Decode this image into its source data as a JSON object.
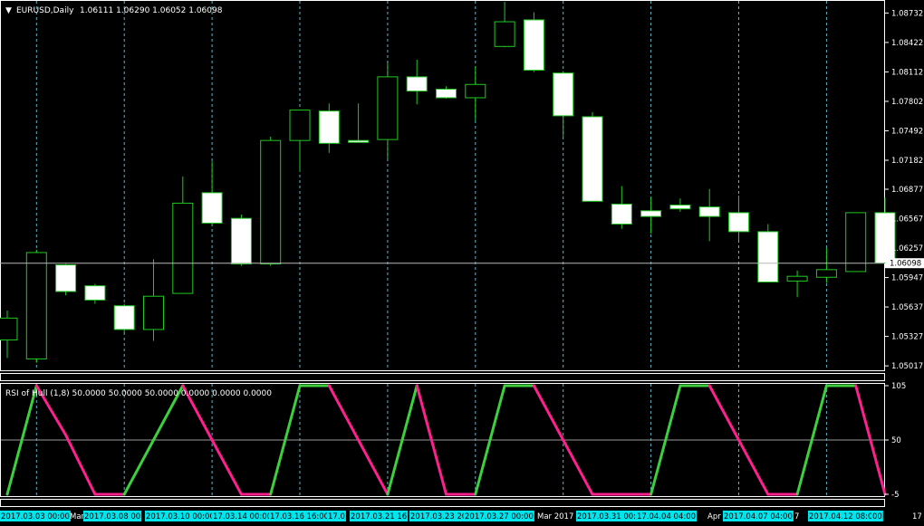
{
  "main_header": {
    "arrow": "▼",
    "symbol": "EURUSD,Daily",
    "ohlc": "1.06111 1.06290 1.06052 1.06098"
  },
  "indicator_header": {
    "text": "RSI of Hull (1,8) 50.0000 50.0000 50.0000 0.0000 0.0000 0.0000"
  },
  "colors": {
    "background": "#000000",
    "grid": "#5fb3c7",
    "bull_outline": "#22c822",
    "candle_fill": "#ffffff",
    "wick": "#22c822",
    "rsi_up": "#3ecf3e",
    "rsi_down": "#ff1f8f",
    "time_label_bg": "#00e5ee"
  },
  "chart_data": [
    {
      "type": "candlestick",
      "symbol": "EURUSD",
      "timeframe": "Daily",
      "y_ticks": [
        "1.08732",
        "1.08422",
        "1.08112",
        "1.07802",
        "1.07492",
        "1.07182",
        "1.06877",
        "1.06567",
        "1.06257",
        "1.05947",
        "1.05637",
        "1.05327",
        "1.05017"
      ],
      "ylim": [
        1.0498,
        1.0885
      ],
      "current_price": "1.06098",
      "candles": [
        {
          "o": 1.0529,
          "h": 1.056,
          "l": 1.051,
          "c": 1.0552
        },
        {
          "o": 1.0509,
          "h": 1.0624,
          "l": 1.0505,
          "c": 1.0621
        },
        {
          "o": 1.0608,
          "h": 1.0609,
          "l": 1.0576,
          "c": 1.058
        },
        {
          "o": 1.0586,
          "h": 1.0588,
          "l": 1.0567,
          "c": 1.0571
        },
        {
          "o": 1.0565,
          "h": 1.0567,
          "l": 1.0536,
          "c": 1.054
        },
        {
          "o": 1.054,
          "h": 1.0614,
          "l": 1.0528,
          "c": 1.0575
        },
        {
          "o": 1.0578,
          "h": 1.0701,
          "l": 1.0578,
          "c": 1.0673
        },
        {
          "o": 1.0684,
          "h": 1.0717,
          "l": 1.065,
          "c": 1.0652
        },
        {
          "o": 1.0657,
          "h": 1.0661,
          "l": 1.0607,
          "c": 1.0609
        },
        {
          "o": 1.0609,
          "h": 1.0743,
          "l": 1.0607,
          "c": 1.0739
        },
        {
          "o": 1.0739,
          "h": 1.0771,
          "l": 1.0706,
          "c": 1.0771
        },
        {
          "o": 1.077,
          "h": 1.0778,
          "l": 1.0726,
          "c": 1.0736
        },
        {
          "o": 1.0739,
          "h": 1.0778,
          "l": 1.0738,
          "c": 1.0737
        },
        {
          "o": 1.074,
          "h": 1.0821,
          "l": 1.072,
          "c": 1.0806
        },
        {
          "o": 1.0806,
          "h": 1.0824,
          "l": 1.0777,
          "c": 1.0791
        },
        {
          "o": 1.0793,
          "h": 1.0796,
          "l": 1.0783,
          "c": 1.0784
        },
        {
          "o": 1.0784,
          "h": 1.0817,
          "l": 1.076,
          "c": 1.0798
        },
        {
          "o": 1.0838,
          "h": 1.0885,
          "l": 1.0837,
          "c": 1.0864
        },
        {
          "o": 1.0866,
          "h": 1.0874,
          "l": 1.0811,
          "c": 1.0813
        },
        {
          "o": 1.081,
          "h": 1.0812,
          "l": 1.0743,
          "c": 1.0765
        },
        {
          "o": 1.0764,
          "h": 1.0769,
          "l": 1.0675,
          "c": 1.0675
        },
        {
          "o": 1.0672,
          "h": 1.0691,
          "l": 1.0646,
          "c": 1.0651
        },
        {
          "o": 1.0665,
          "h": 1.0679,
          "l": 1.0641,
          "c": 1.0659
        },
        {
          "o": 1.0671,
          "h": 1.0678,
          "l": 1.0664,
          "c": 1.0667
        },
        {
          "o": 1.0669,
          "h": 1.0688,
          "l": 1.0633,
          "c": 1.0659
        },
        {
          "o": 1.0663,
          "h": 1.0681,
          "l": 1.0634,
          "c": 1.0643
        },
        {
          "o": 1.0643,
          "h": 1.0651,
          "l": 1.059,
          "c": 1.059
        },
        {
          "o": 1.0591,
          "h": 1.0602,
          "l": 1.0574,
          "c": 1.0596
        },
        {
          "o": 1.0595,
          "h": 1.0626,
          "l": 1.0589,
          "c": 1.0603
        },
        {
          "o": 1.0601,
          "h": 1.0663,
          "l": 1.0601,
          "c": 1.0663
        },
        {
          "o": 1.0663,
          "h": 1.0679,
          "l": 1.0611,
          "c": 1.061
        }
      ]
    },
    {
      "type": "line",
      "title": "RSI of Hull (1,8)",
      "y_ticks": [
        "105",
        "50",
        "-5"
      ],
      "ylim": [
        -5,
        105
      ],
      "values": [
        -5,
        105,
        55,
        -5,
        -5,
        50,
        105,
        50,
        -5,
        -5,
        105,
        105,
        50,
        -5,
        105,
        -5,
        -5,
        105,
        105,
        50,
        -5,
        -5,
        -5,
        105,
        105,
        50,
        -5,
        -5,
        105,
        105,
        -5
      ]
    }
  ],
  "time_axis": {
    "labels": [
      {
        "text": "2017.03.03 00:00",
        "highlight": true
      },
      {
        "text": "Mar",
        "highlight": false
      },
      {
        "text": "2017.03.08 00",
        "highlight": true
      },
      {
        "text": "2017.03.10 00:00",
        "highlight": true
      },
      {
        "text": "17.03.14 00:00",
        "highlight": true
      },
      {
        "text": "17.03.16 16:00",
        "highlight": true
      },
      {
        "text": "17.0",
        "highlight": true
      },
      {
        "text": "2017.03.21 16",
        "highlight": true
      },
      {
        "text": "2017.03.23 20",
        "highlight": true
      },
      {
        "text": "2017.03.27 00:00",
        "highlight": true
      },
      {
        "text": "Mar 2017",
        "highlight": false
      },
      {
        "text": "2017.03.31 00:00",
        "highlight": true
      },
      {
        "text": "17.04.04 04:00",
        "highlight": true
      },
      {
        "text": "Apr",
        "highlight": false
      },
      {
        "text": "2017.04.07 04:00",
        "highlight": true
      },
      {
        "text": "7",
        "highlight": false
      },
      {
        "text": "2017.04.12 08:00",
        "highlight": true
      },
      {
        "text": "00",
        "highlight": true
      },
      {
        "text": "17",
        "highlight": false
      }
    ]
  }
}
